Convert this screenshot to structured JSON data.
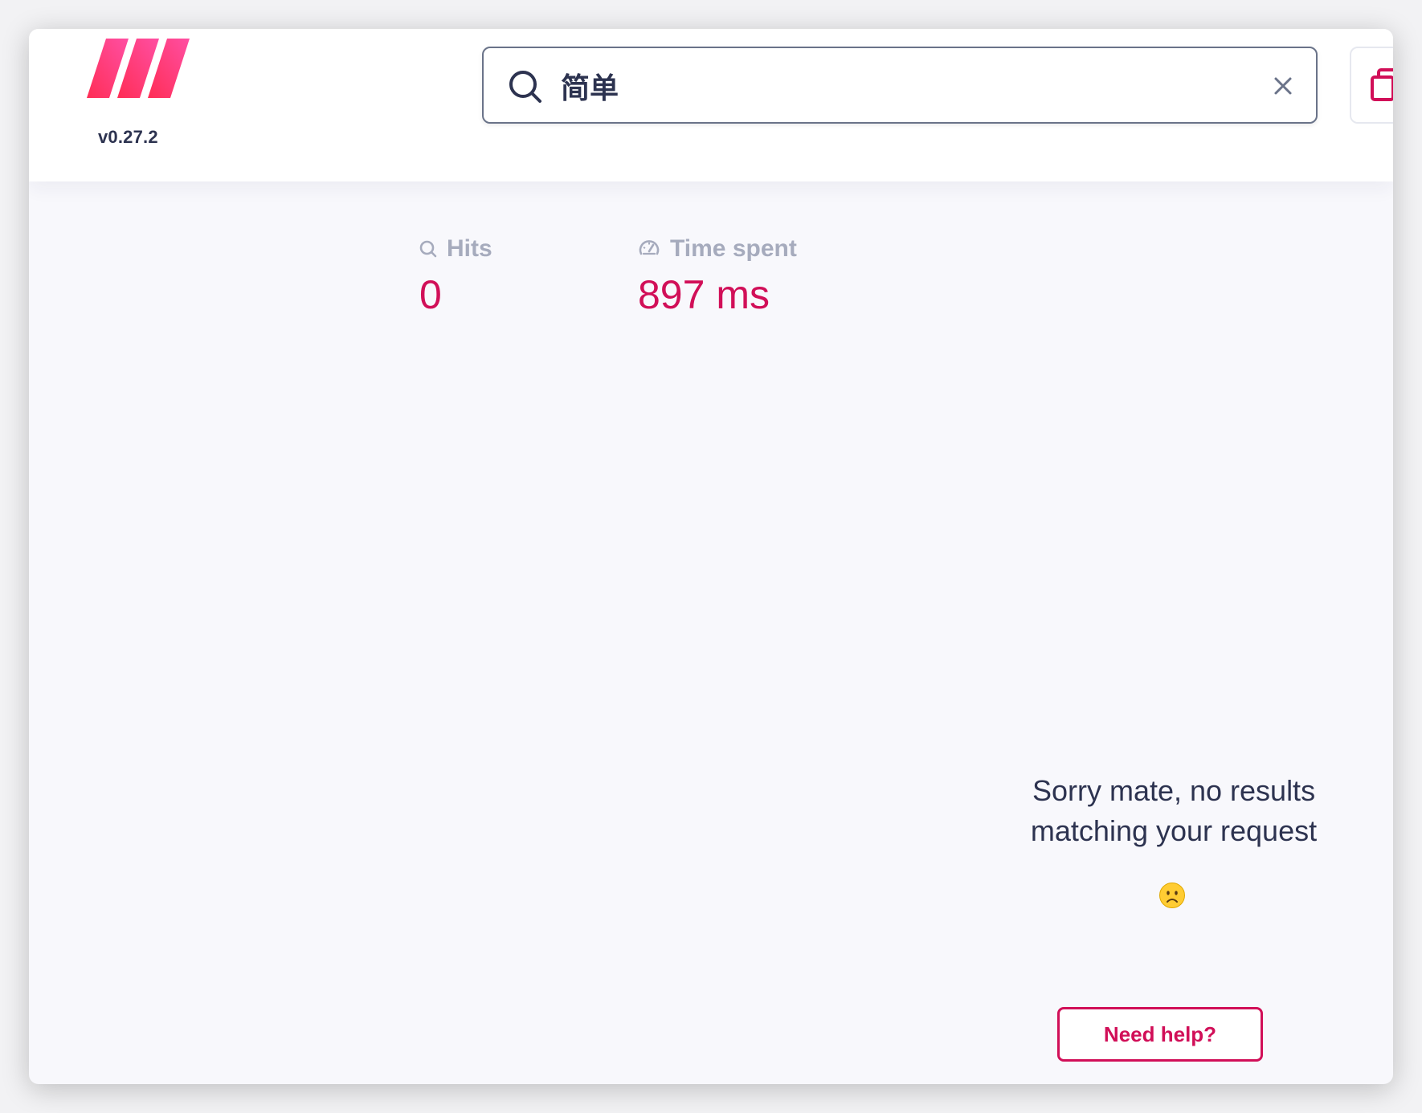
{
  "app": {
    "version": "v0.27.2",
    "brand_color": "#d10f58",
    "logo_colors": [
      "#ff2d55",
      "#ff4fa3"
    ]
  },
  "search": {
    "query": "简单",
    "icon": "search-icon",
    "clear_icon": "close-icon"
  },
  "toolbar": {
    "side_button_icon": "copy-icon"
  },
  "stats": {
    "hits": {
      "label": "Hits",
      "value": "0",
      "icon": "search-icon"
    },
    "time": {
      "label": "Time spent",
      "value": "897 ms",
      "icon": "speedometer-icon"
    }
  },
  "empty_state": {
    "line1": "Sorry mate, no results",
    "line2": "matching your request",
    "emoji": "frowning-face-emoji"
  },
  "help": {
    "label": "Need help?"
  }
}
